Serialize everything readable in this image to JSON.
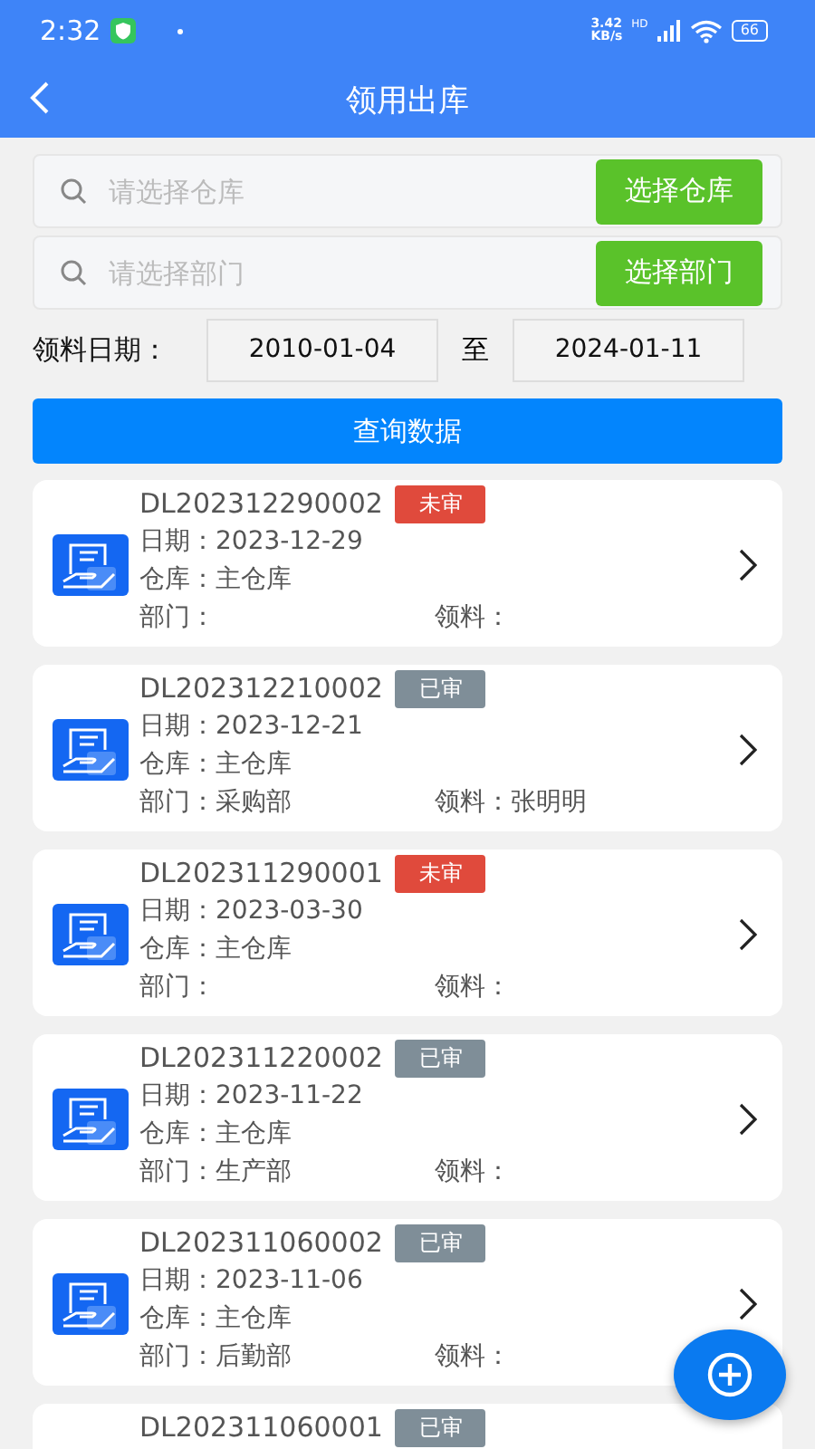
{
  "status_bar": {
    "time": "2:32",
    "net_speed": "3.42\nKB/s",
    "network": "HD",
    "battery": "66"
  },
  "header": {
    "title": "领用出库"
  },
  "filters": [
    {
      "placeholder": "请选择仓库",
      "button": "选择仓库"
    },
    {
      "placeholder": "请选择部门",
      "button": "选择部门"
    }
  ],
  "date_range": {
    "label": "领料日期：",
    "from": "2010-01-04",
    "separator": "至",
    "to": "2024-01-11"
  },
  "query_button": "查询数据",
  "records": [
    {
      "number": "DL202312290002",
      "status": "未审",
      "approved": false,
      "date": "日期：2023-12-29",
      "warehouse": "仓库：主仓库",
      "department": "部门：",
      "receiver": "领料："
    },
    {
      "number": "DL202312210002",
      "status": "已审",
      "approved": true,
      "date": "日期：2023-12-21",
      "warehouse": "仓库：主仓库",
      "department": "部门：采购部",
      "receiver": "领料：张明明"
    },
    {
      "number": "DL202311290001",
      "status": "未审",
      "approved": false,
      "date": "日期：2023-03-30",
      "warehouse": "仓库：主仓库",
      "department": "部门：",
      "receiver": "领料："
    },
    {
      "number": "DL202311220002",
      "status": "已审",
      "approved": true,
      "date": "日期：2023-11-22",
      "warehouse": "仓库：主仓库",
      "department": "部门：生产部",
      "receiver": "领料："
    },
    {
      "number": "DL202311060002",
      "status": "已审",
      "approved": true,
      "date": "日期：2023-11-06",
      "warehouse": "仓库：主仓库",
      "department": "部门：后勤部",
      "receiver": "领料："
    },
    {
      "number": "DL202311060001",
      "status": "已审",
      "approved": true
    }
  ]
}
